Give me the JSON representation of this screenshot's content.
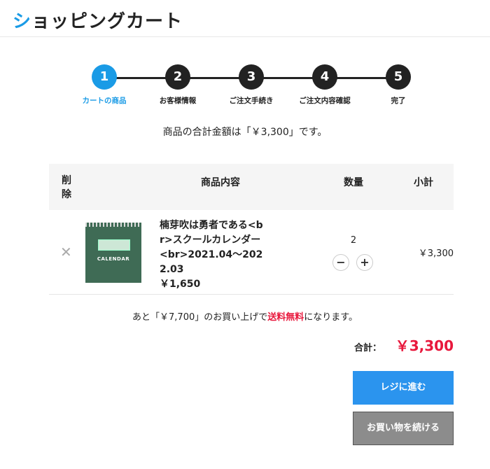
{
  "header": {
    "title_first_char": "シ",
    "title_rest": "ョッピングカート"
  },
  "steps": [
    {
      "number": "1",
      "label": "カートの商品",
      "active": true
    },
    {
      "number": "2",
      "label": "お客様情報",
      "active": false
    },
    {
      "number": "3",
      "label": "ご注文手続き",
      "active": false
    },
    {
      "number": "4",
      "label": "ご注文内容確認",
      "active": false
    },
    {
      "number": "5",
      "label": "完了",
      "active": false
    }
  ],
  "total_message": "商品の合計金額は「￥3,300」です。",
  "table": {
    "headers": {
      "delete": "削除",
      "content": "商品内容",
      "quantity": "数量",
      "subtotal": "小計"
    },
    "rows": [
      {
        "remove_icon": "close-icon",
        "image_text": "CALENDAR",
        "name": "楠芽吹は勇者である<br>スクールカレンダー<br>2021.04～2022.03",
        "price": "￥1,650",
        "quantity": "2",
        "minus_label": "−",
        "plus_label": "+",
        "subtotal": "￥3,300"
      }
    ]
  },
  "free_shipping": {
    "prefix": "あと「￥7,700」のお買い上げで",
    "highlight": "送料無料",
    "suffix": "になります。"
  },
  "grand_total": {
    "label": "合計：",
    "value": "￥3,300"
  },
  "buttons": {
    "checkout": "レジに進む",
    "continue": "お買い物を続ける"
  },
  "colors": {
    "accent": "#1a9be6",
    "price_red": "#e8183c",
    "checkout_bg": "#2b94ee",
    "continue_bg": "#8c8c8c"
  }
}
